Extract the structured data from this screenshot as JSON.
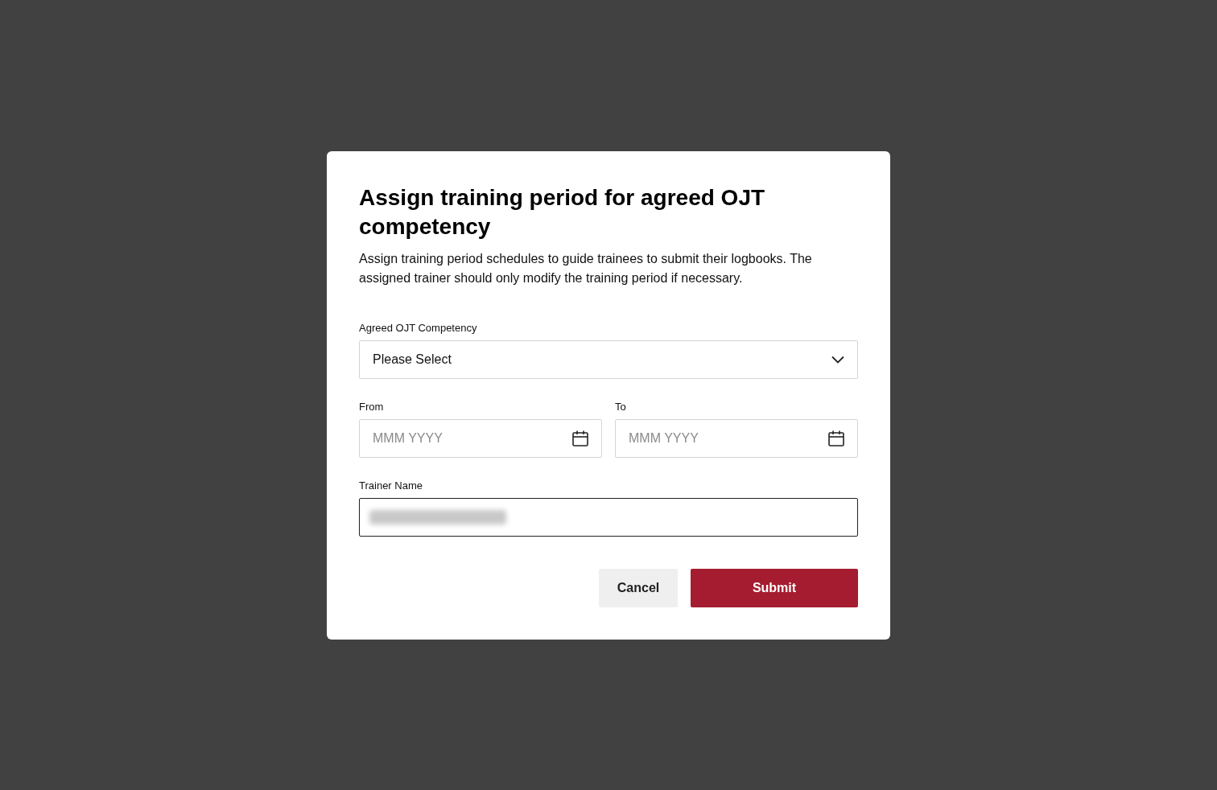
{
  "dialog": {
    "title": "Assign training period for agreed OJT competency",
    "description": "Assign training period schedules to guide trainees to submit their logbooks. The assigned trainer should only modify the training period if necessary.",
    "competency": {
      "label": "Agreed OJT Competency",
      "value": "Please Select"
    },
    "from": {
      "label": "From",
      "placeholder": "MMM YYYY"
    },
    "to": {
      "label": "To",
      "placeholder": "MMM YYYY"
    },
    "trainer": {
      "label": "Trainer Name",
      "focused": true,
      "redacted": true
    },
    "buttons": [
      {
        "label": "Cancel",
        "kind": "secondary"
      },
      {
        "label": "Submit",
        "kind": "primary"
      }
    ]
  }
}
